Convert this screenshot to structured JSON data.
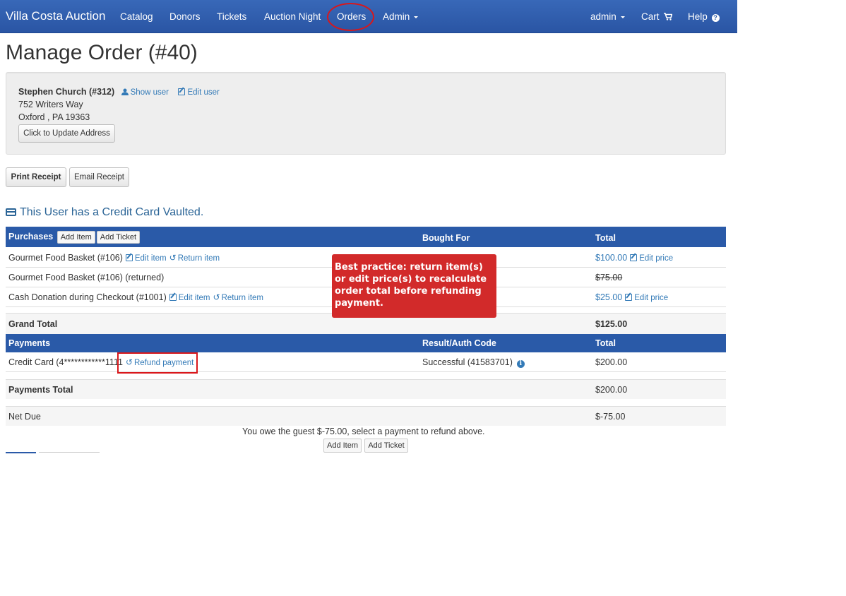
{
  "navbar": {
    "brand": "Villa Costa Auction",
    "items": [
      {
        "label": "Catalog"
      },
      {
        "label": "Donors"
      },
      {
        "label": "Tickets"
      },
      {
        "label": "Auction Night"
      },
      {
        "label": "Orders"
      },
      {
        "label": "Admin"
      }
    ],
    "right": {
      "admin": "admin",
      "cart": "Cart",
      "help": "Help"
    },
    "color": "#2a5aa8"
  },
  "page": {
    "title": "Manage Order (#40)"
  },
  "user": {
    "name": "Stephen Church (#312)",
    "show_user": "Show user",
    "edit_user": "Edit user",
    "address_line1": "752 Writers Way",
    "address_line2": "Oxford , PA 19363",
    "update_button": "Click to Update Address"
  },
  "actions": {
    "print_receipt": "Print Receipt",
    "email_receipt": "Email Receipt"
  },
  "vault_message": "This User has a Credit Card Vaulted.",
  "purchases": {
    "header": "Purchases",
    "add_item": "Add Item",
    "add_ticket": "Add Ticket",
    "col_bought_for": "Bought For",
    "col_total": "Total",
    "rows": [
      {
        "name": "Gourmet Food Basket (#106)",
        "edit": "Edit item",
        "return": "Return item",
        "total": "$100.00",
        "edit_price": "Edit price"
      },
      {
        "name": "Gourmet Food Basket (#106) (returned)",
        "total": "$75.00"
      },
      {
        "name": "Cash Donation during Checkout (#1001)",
        "edit": "Edit item",
        "return": "Return item",
        "total": "$25.00",
        "edit_price": "Edit price"
      }
    ],
    "grand_total_label": "Grand Total",
    "grand_total": "$125.00"
  },
  "payments": {
    "header": "Payments",
    "col_result": "Result/Auth Code",
    "col_total": "Total",
    "rows": [
      {
        "method": "Credit Card (4************1111",
        "refund": "Refund payment",
        "result": "Successful (41583701)",
        "total": "$200.00"
      }
    ],
    "total_label": "Payments Total",
    "total": "$200.00",
    "net_due_label": "Net Due",
    "net_due": "$-75.00"
  },
  "callout": "Best practice:  return item(s) or edit price(s) to recalculate order total before refunding payment.",
  "owe_message": "You owe the guest $-75.00, select a payment to refund above.",
  "bottom": {
    "add_item": "Add Item",
    "add_ticket": "Add Ticket"
  }
}
